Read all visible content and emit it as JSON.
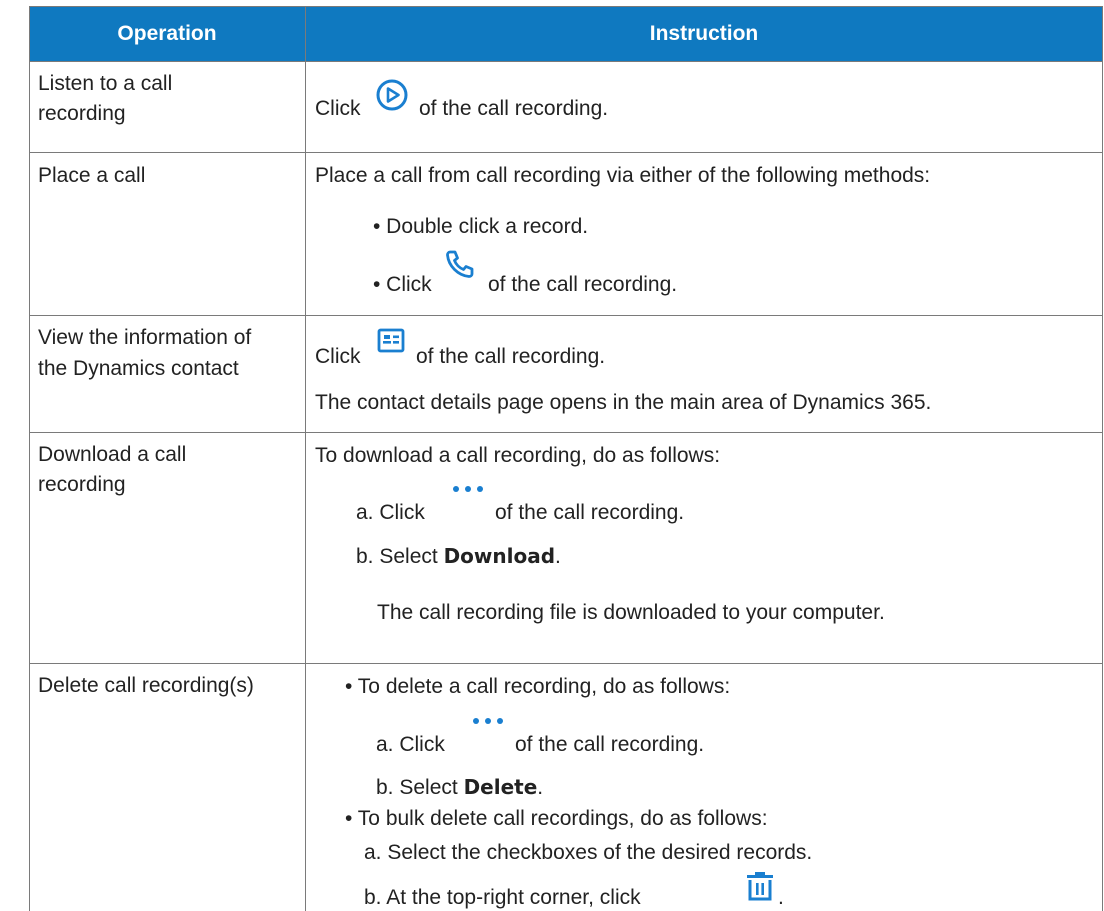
{
  "colors": {
    "header_bg": "#0f79c0",
    "icon_blue": "#1a7fd0",
    "grid": "#7a7a7a"
  },
  "header": {
    "col1": "Operation",
    "col2": "Instruction"
  },
  "rows": [
    {
      "operation_line1": "Listen to a call",
      "operation_line2": "recording",
      "click": "Click",
      "icon": "play-circle-icon",
      "after_icon": "of the call recording."
    },
    {
      "operation": "Place a call",
      "intro": "Place a call from call recording via either of the following methods:",
      "bullet1": "• Double click a record.",
      "bullet2_prefix": "• Click",
      "icon": "phone-icon",
      "bullet2_suffix": "of the call recording."
    },
    {
      "operation_line1": "View the information of",
      "operation_line2": "the Dynamics contact",
      "click": "Click",
      "icon": "contact-card-icon",
      "after_icon": "of the call recording.",
      "note": "The contact details page opens in the main area of Dynamics 365."
    },
    {
      "operation_line1": "Download a call",
      "operation_line2": "recording",
      "intro": "To download a call recording, do as follows:",
      "step_a_prefix": "a. Click",
      "icon": "more-icon",
      "step_a_suffix": "of the call recording.",
      "step_b_prefix": "b. Select",
      "step_b_bold": "Download",
      "step_b_suffix": ".",
      "note": "The call recording file is downloaded to your computer."
    },
    {
      "operation": "Delete call recording(s)",
      "bullet1": "• To delete a call recording, do as follows:",
      "b1_step_a_prefix": "a. Click",
      "icon1": "more-icon",
      "b1_step_a_suffix": "of the call recording.",
      "b1_step_b_prefix": "b. Select",
      "b1_step_b_bold": "Delete",
      "b1_step_b_suffix": ".",
      "bullet2": "• To bulk delete call recordings, do as follows:",
      "b2_step_a": "a. Select the checkboxes of the desired records.",
      "b2_step_b_prefix": "b. At the top-right corner, click",
      "icon2": "trash-icon",
      "b2_step_b_suffix": "."
    }
  ]
}
